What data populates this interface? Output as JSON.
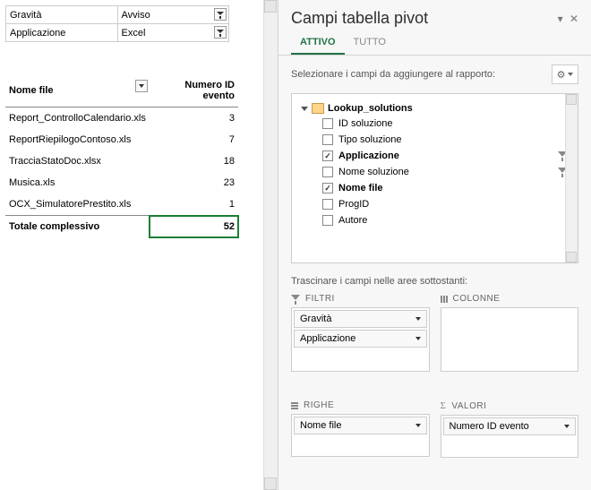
{
  "filters_area": {
    "rows": [
      {
        "label": "Gravità",
        "value": "Avviso"
      },
      {
        "label": "Applicazione",
        "value": "Excel"
      }
    ]
  },
  "pivot": {
    "row_header": "Nome file",
    "value_header": "Numero ID evento",
    "rows": [
      {
        "label": "Report_ControlloCalendario.xls",
        "value": "3"
      },
      {
        "label": "ReportRiepilogoContoso.xls",
        "value": "7"
      },
      {
        "label": "TracciaStatoDoc.xlsx",
        "value": "18"
      },
      {
        "label": "Musica.xls",
        "value": "23"
      },
      {
        "label": "OCX_SimulatorePrestito.xls",
        "value": "1"
      }
    ],
    "total_label": "Totale complessivo",
    "total_value": "52"
  },
  "pane": {
    "title": "Campi tabella pivot",
    "tabs": {
      "active": "ATTIVO",
      "all": "TUTTO"
    },
    "subheader": "Selezionare i campi da aggiungere al rapporto:",
    "table_name": "Lookup_solutions",
    "fields": [
      {
        "label": "ID soluzione",
        "checked": false,
        "filter": false
      },
      {
        "label": "Tipo soluzione",
        "checked": false,
        "filter": false
      },
      {
        "label": "Applicazione",
        "checked": true,
        "filter": true
      },
      {
        "label": "Nome soluzione",
        "checked": false,
        "filter": true
      },
      {
        "label": "Nome file",
        "checked": true,
        "filter": false
      },
      {
        "label": "ProgID",
        "checked": false,
        "filter": false
      },
      {
        "label": "Autore",
        "checked": false,
        "filter": false
      }
    ],
    "drag_hint": "Trascinare i campi nelle aree sottostanti:",
    "areas": {
      "filters_label": "FILTRI",
      "columns_label": "COLONNE",
      "rows_label": "RIGHE",
      "values_label": "VALORI",
      "filters_items": [
        "Gravità",
        "Applicazione"
      ],
      "rows_items": [
        "Nome file"
      ],
      "values_items": [
        "Numero ID evento"
      ]
    }
  }
}
